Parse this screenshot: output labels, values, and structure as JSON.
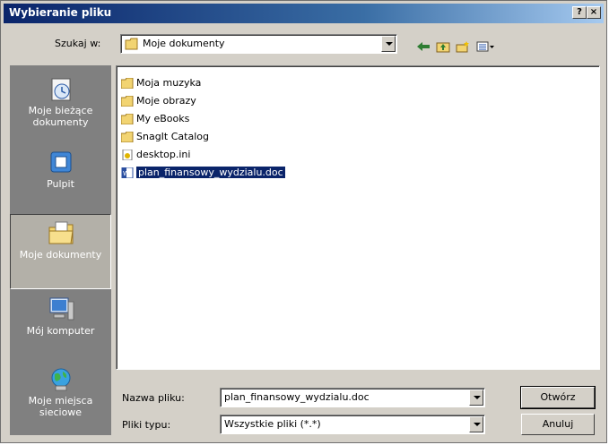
{
  "window": {
    "title": "Wybieranie pliku",
    "help_button": "?",
    "close_button": "×"
  },
  "lookin": {
    "label": "Szukaj w:",
    "value": "Moje dokumenty"
  },
  "toolbar": {
    "back_icon": "back-arrow-icon",
    "up_icon": "up-folder-icon",
    "new_folder_icon": "new-folder-icon",
    "views_icon": "views-menu-icon"
  },
  "places": [
    {
      "label": "Moje bieżące dokumenty",
      "icon": "recent-documents-icon"
    },
    {
      "label": "Pulpit",
      "icon": "desktop-icon"
    },
    {
      "label": "Moje dokumenty",
      "icon": "my-documents-icon"
    },
    {
      "label": "Mój komputer",
      "icon": "my-computer-icon"
    },
    {
      "label": "Moje miejsca sieciowe",
      "icon": "network-places-icon"
    }
  ],
  "files": [
    {
      "name": "Moja muzyka",
      "type": "folder"
    },
    {
      "name": "Moje obrazy",
      "type": "folder"
    },
    {
      "name": "My eBooks",
      "type": "folder"
    },
    {
      "name": "SnagIt Catalog",
      "type": "folder"
    },
    {
      "name": "desktop.ini",
      "type": "ini"
    },
    {
      "name": "plan_finansowy_wydzialu.doc",
      "type": "doc",
      "selected": true
    }
  ],
  "filename": {
    "label": "Nazwa pliku:",
    "value": "plan_finansowy_wydzialu.doc"
  },
  "filetype": {
    "label": "Pliki typu:",
    "value": "Wszystkie pliki (*.*)"
  },
  "buttons": {
    "open": "Otwórz",
    "cancel": "Anuluj"
  },
  "colors": {
    "title_start": "#0a246a",
    "title_end": "#a6caf0",
    "selection": "#0a246a",
    "face": "#d4d0c8",
    "places_bg": "#808080"
  }
}
